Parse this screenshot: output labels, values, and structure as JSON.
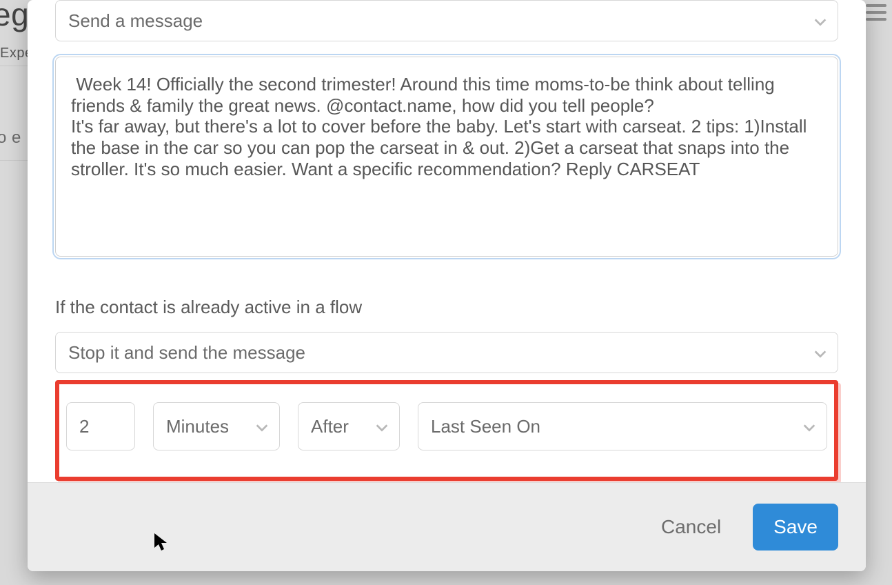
{
  "background": {
    "frag_reg": "eg",
    "frag_expe": "Expe",
    "frag_oe": "o e"
  },
  "action_select": {
    "label": "Send a message"
  },
  "message_text": " Week 14! Officially the second trimester! Around this time moms-to-be think about telling friends & family the great news. @contact.name, how did you tell people?\nIt's far away, but there's a lot to cover before the baby. Let's start with carseat. 2 tips: 1)Install the base in the car so you can pop the carseat in & out. 2)Get a carseat that snaps into the stroller. It's so much easier. Want a specific recommendation? Reply CARSEAT",
  "flow_section_label": "If the contact is already active in a flow",
  "flow_select": {
    "label": "Stop it and send the message"
  },
  "timing": {
    "amount": "2",
    "unit": "Minutes",
    "relation": "After",
    "anchor": "Last Seen On"
  },
  "footer": {
    "cancel": "Cancel",
    "save": "Save"
  },
  "colors": {
    "highlight": "#ea3d2f",
    "primary": "#2f8bd8"
  }
}
